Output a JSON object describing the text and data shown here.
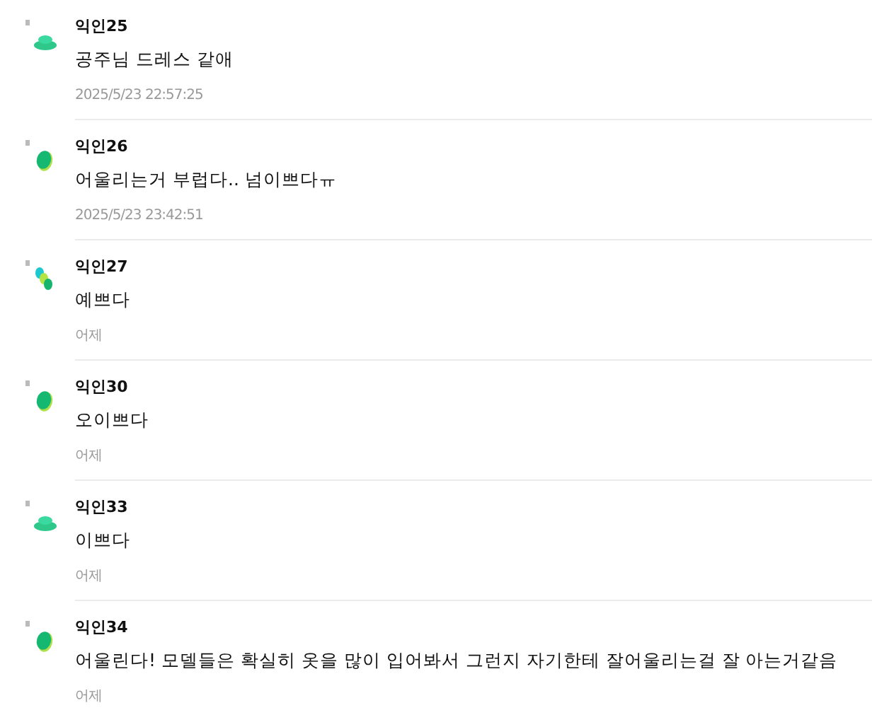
{
  "comments": [
    {
      "author": "익인25",
      "text": "공주님 드레스 같애",
      "time": "2025/5/23 22:57:25",
      "avatar": {
        "kind": "hat"
      }
    },
    {
      "author": "익인26",
      "text": "어울리는거 부럽다.. 넘이쁘다ㅠ",
      "time": "2025/5/23 23:42:51",
      "avatar": {
        "kind": "leaf"
      }
    },
    {
      "author": "익인27",
      "text": "예쁘다",
      "time": "어제",
      "avatar": {
        "kind": "dots"
      }
    },
    {
      "author": "익인30",
      "text": "오이쁘다",
      "time": "어제",
      "avatar": {
        "kind": "leaf"
      }
    },
    {
      "author": "익인33",
      "text": "이쁘다",
      "time": "어제",
      "avatar": {
        "kind": "hat"
      }
    },
    {
      "author": "익인34",
      "text": "어울린다! 모델들은 확실히 옷을 많이 입어봐서 그런지 자기한테 잘어울리는걸 잘 아는거같음",
      "time": "어제",
      "avatar": {
        "kind": "leaf"
      }
    }
  ]
}
